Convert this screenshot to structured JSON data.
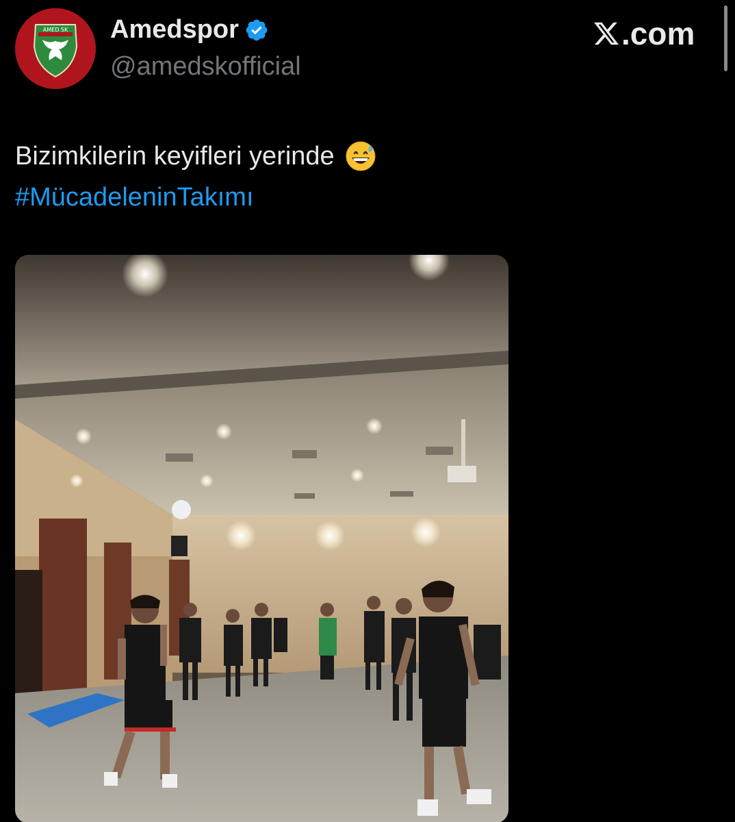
{
  "account": {
    "display_name": "Amedspor",
    "handle": "@amedskofficial",
    "verified": true,
    "avatar_label": "AMED SK",
    "avatar_color": "#b0151e",
    "avatar_inner_color": "#2e8b3d"
  },
  "brand": {
    "site": ".com",
    "logo": "x-logo-icon"
  },
  "tweet": {
    "text": "Bizimkilerin keyifleri yerinde",
    "emoji": "grinning-face-with-sweat-icon",
    "hashtag": "#MücadeleninTakımı",
    "hashtag_color": "#1d9bf0"
  },
  "media": {
    "type": "video",
    "content": "players-juggling-ball-in-hotel-hall"
  },
  "colors": {
    "background": "#000000",
    "text": "#e7e9ea",
    "muted": "#71767b",
    "verified_badge": "#1d9bf0"
  }
}
